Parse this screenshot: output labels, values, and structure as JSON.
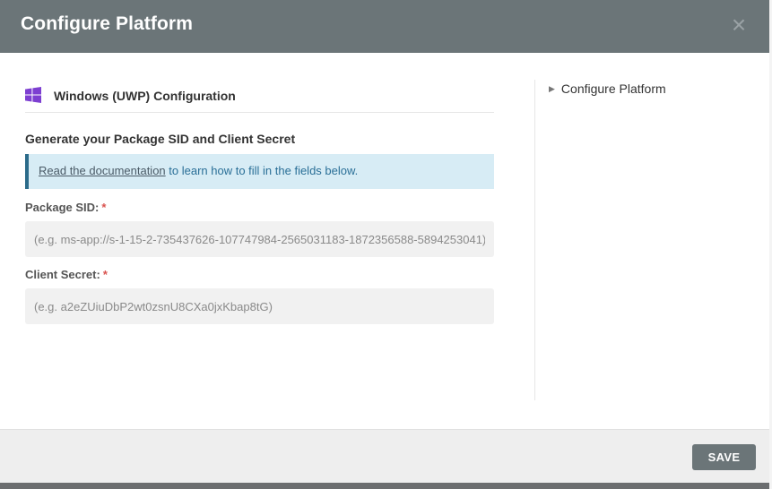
{
  "modal": {
    "title": "Configure Platform",
    "close_glyph": "×"
  },
  "section": {
    "icon": "windows-logo-icon",
    "title": "Windows (UWP) Configuration",
    "subtitle": "Generate your Package SID and Client Secret"
  },
  "info": {
    "link_text": "Read the documentation",
    "text": " to learn how to fill in the fields below."
  },
  "fields": {
    "package_sid": {
      "label": "Package SID:",
      "required": "*",
      "value": "",
      "placeholder": "(e.g. ms-app://s-1-15-2-735437626-107747984-2565031183-1872356588-5894253041)"
    },
    "client_secret": {
      "label": "Client Secret:",
      "required": "*",
      "value": "",
      "placeholder": "(e.g. a2eZUiuDbP2wt0zsnU8CXa0jxKbap8tG)"
    }
  },
  "sidebar": {
    "items": [
      {
        "label": "Configure Platform",
        "icon": "caret-right-icon"
      }
    ]
  },
  "footer": {
    "save_label": "SAVE"
  },
  "colors": {
    "header_bg": "#6b7578",
    "windows_purple": "#7d3fd1",
    "info_bg": "#d7ecf5",
    "info_border": "#2b6b8a",
    "required": "#d9534f"
  }
}
